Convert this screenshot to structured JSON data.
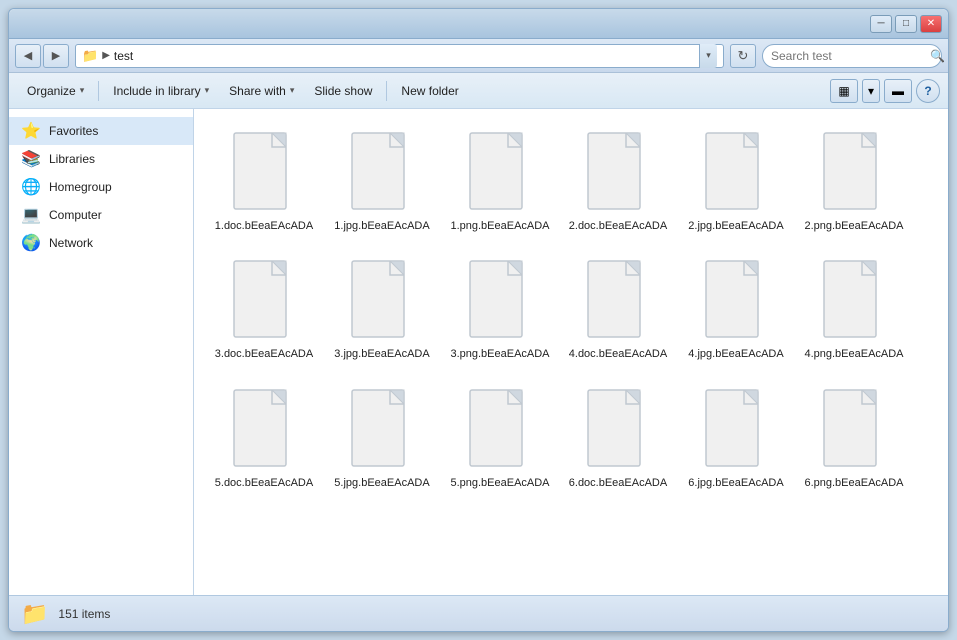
{
  "window": {
    "title": "test",
    "title_bar_buttons": {
      "minimize": "─",
      "maximize": "□",
      "close": "✕"
    }
  },
  "address_bar": {
    "back": "◀",
    "forward": "▶",
    "folder_icon": "📁",
    "arrow": "▶",
    "path": "test",
    "dropdown": "▾",
    "refresh": "↻",
    "search_placeholder": "Search test",
    "search_icon": "🔍"
  },
  "toolbar": {
    "organize": "Organize",
    "include_in_library": "Include in library",
    "share_with": "Share with",
    "slide_show": "Slide show",
    "new_folder": "New folder",
    "chevron": "▾",
    "view_icon": "▦",
    "view_dropdown": "▾",
    "details_icon": "▬",
    "help": "?"
  },
  "sidebar": {
    "items": [
      {
        "id": "favorites",
        "label": "Favorites",
        "icon": "⭐"
      },
      {
        "id": "libraries",
        "label": "Libraries",
        "icon": "📚"
      },
      {
        "id": "homegroup",
        "label": "Homegroup",
        "icon": "🌐"
      },
      {
        "id": "computer",
        "label": "Computer",
        "icon": "💻"
      },
      {
        "id": "network",
        "label": "Network",
        "icon": "🌍"
      }
    ]
  },
  "files": [
    {
      "id": 1,
      "name": "1.doc.bEeaEAcADA"
    },
    {
      "id": 2,
      "name": "1.jpg.bEeaEAcADA"
    },
    {
      "id": 3,
      "name": "1.png.bEeaEAcADA"
    },
    {
      "id": 4,
      "name": "2.doc.bEeaEAcADA"
    },
    {
      "id": 5,
      "name": "2.jpg.bEeaEAcADA"
    },
    {
      "id": 6,
      "name": "2.png.bEeaEAcADA"
    },
    {
      "id": 7,
      "name": "3.doc.bEeaEAcADA"
    },
    {
      "id": 8,
      "name": "3.jpg.bEeaEAcADA"
    },
    {
      "id": 9,
      "name": "3.png.bEeaEAcADA"
    },
    {
      "id": 10,
      "name": "4.doc.bEeaEAcADA"
    },
    {
      "id": 11,
      "name": "4.jpg.bEeaEAcADA"
    },
    {
      "id": 12,
      "name": "4.png.bEeaEAcADA"
    },
    {
      "id": 13,
      "name": "5.doc.bEeaEAcADA"
    },
    {
      "id": 14,
      "name": "5.jpg.bEeaEAcADA"
    },
    {
      "id": 15,
      "name": "5.png.bEeaEAcADA"
    },
    {
      "id": 16,
      "name": "6.doc.bEeaEAcADA"
    },
    {
      "id": 17,
      "name": "6.jpg.bEeaEAcADA"
    },
    {
      "id": 18,
      "name": "6.png.bEeaEAcADA"
    }
  ],
  "status_bar": {
    "item_count": "151 items",
    "folder_icon": "📁"
  }
}
